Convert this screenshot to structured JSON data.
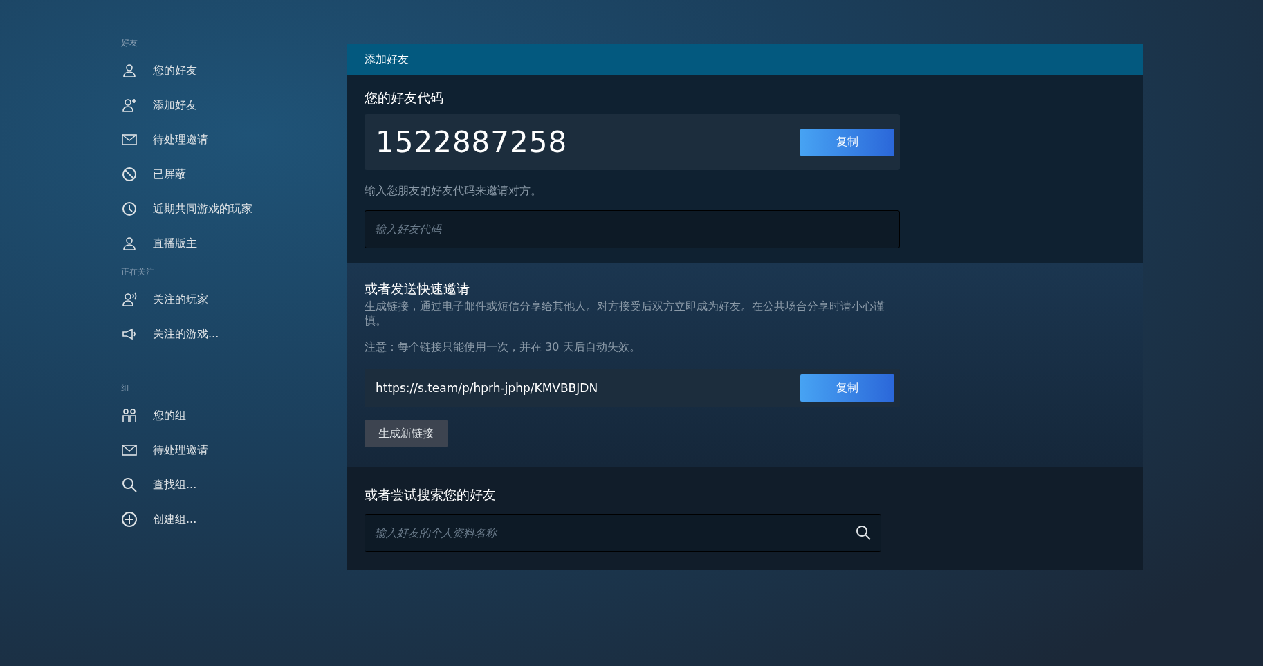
{
  "sidebar": {
    "sections": [
      {
        "title": "好友",
        "items": [
          {
            "label": "您的好友"
          },
          {
            "label": "添加好友"
          },
          {
            "label": "待处理邀请"
          },
          {
            "label": "已屏蔽"
          },
          {
            "label": "近期共同游戏的玩家"
          },
          {
            "label": "直播版主"
          }
        ]
      },
      {
        "title": "正在关注",
        "items": [
          {
            "label": "关注的玩家"
          },
          {
            "label": "关注的游戏..."
          }
        ]
      },
      {
        "title": "组",
        "items": [
          {
            "label": "您的组"
          },
          {
            "label": "待处理邀请"
          },
          {
            "label": "查找组..."
          },
          {
            "label": "创建组..."
          }
        ]
      }
    ]
  },
  "panel": {
    "title": "添加好友",
    "friend_code": {
      "heading": "您的好友代码",
      "code": "1522887258",
      "copy_button": "复制",
      "hint": "输入您朋友的好友代码来邀请对方。",
      "input_placeholder": "输入好友代码"
    },
    "quick_invite": {
      "heading": "或者发送快速邀请",
      "description": "生成链接，通过电子邮件或短信分享给其他人。对方接受后双方立即成为好友。在公共场合分享时请小心谨慎。",
      "note": "注意：每个链接只能使用一次，并在 30 天后自动失效。",
      "link": "https://s.team/p/hprh-jphp/KMVBBJDN",
      "copy_button": "复制",
      "new_link_button": "生成新链接"
    },
    "search": {
      "heading": "或者尝试搜索您的好友",
      "placeholder": "输入好友的个人资料名称"
    }
  }
}
